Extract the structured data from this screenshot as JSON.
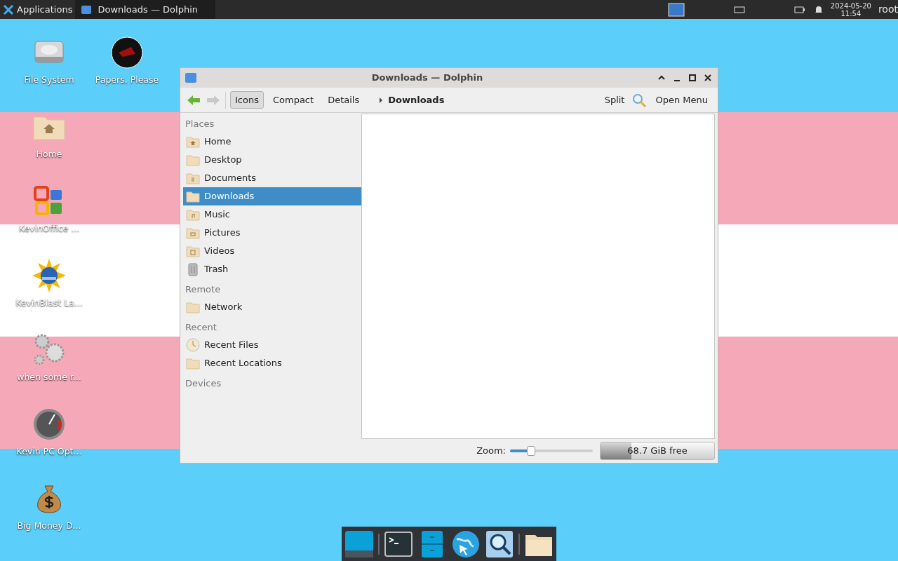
{
  "panel": {
    "apps_label": "Applications",
    "windows": [
      {
        "title": "Downloads — Dolphin",
        "selected": true
      }
    ],
    "date": "2024-05-20",
    "time": "11:54",
    "user": "root"
  },
  "desktop_icons": [
    {
      "label": "File System",
      "kind": "drive"
    },
    {
      "label": "Papers, Please",
      "kind": "game"
    },
    {
      "label": "Home",
      "kind": "home"
    },
    {
      "label": "KevinOffice ...",
      "kind": "office"
    },
    {
      "label": "KevinBlast La...",
      "kind": "blast"
    },
    {
      "label": "when some r...",
      "kind": "gears"
    },
    {
      "label": "Kevin PC Opt...",
      "kind": "gauge"
    },
    {
      "label": "Big Money D...",
      "kind": "money"
    }
  ],
  "window": {
    "title": "Downloads — Dolphin",
    "toolbar": {
      "views": [
        {
          "label": "Icons",
          "selected": true
        },
        {
          "label": "Compact",
          "selected": false
        },
        {
          "label": "Details",
          "selected": false
        }
      ],
      "location": "Downloads",
      "split": "Split",
      "menu": "Open Menu"
    },
    "sidebar": [
      {
        "heading": "Places",
        "items": [
          {
            "label": "Home",
            "kind": "home",
            "selected": false
          },
          {
            "label": "Desktop",
            "kind": "folder",
            "selected": false
          },
          {
            "label": "Documents",
            "kind": "docs",
            "selected": false
          },
          {
            "label": "Downloads",
            "kind": "folder",
            "selected": true
          },
          {
            "label": "Music",
            "kind": "music",
            "selected": false
          },
          {
            "label": "Pictures",
            "kind": "pictures",
            "selected": false
          },
          {
            "label": "Videos",
            "kind": "videos",
            "selected": false
          },
          {
            "label": "Trash",
            "kind": "trash",
            "selected": false
          }
        ]
      },
      {
        "heading": "Remote",
        "items": [
          {
            "label": "Network",
            "kind": "folder",
            "selected": false
          }
        ]
      },
      {
        "heading": "Recent",
        "items": [
          {
            "label": "Recent Files",
            "kind": "clock",
            "selected": false
          },
          {
            "label": "Recent Locations",
            "kind": "folder",
            "selected": false
          }
        ]
      },
      {
        "heading": "Devices"
      }
    ],
    "status": {
      "zoom_label": "Zoom:",
      "zoom": {
        "level": 0.25
      },
      "free_space": {
        "label": "68.7 GiB free",
        "level": 0.27
      }
    }
  },
  "dock": [
    {
      "kind": "desktop"
    },
    {
      "kind": "terminal"
    },
    {
      "kind": "cabinet"
    },
    {
      "kind": "browser"
    },
    {
      "kind": "search"
    },
    {
      "kind": "folder"
    }
  ]
}
